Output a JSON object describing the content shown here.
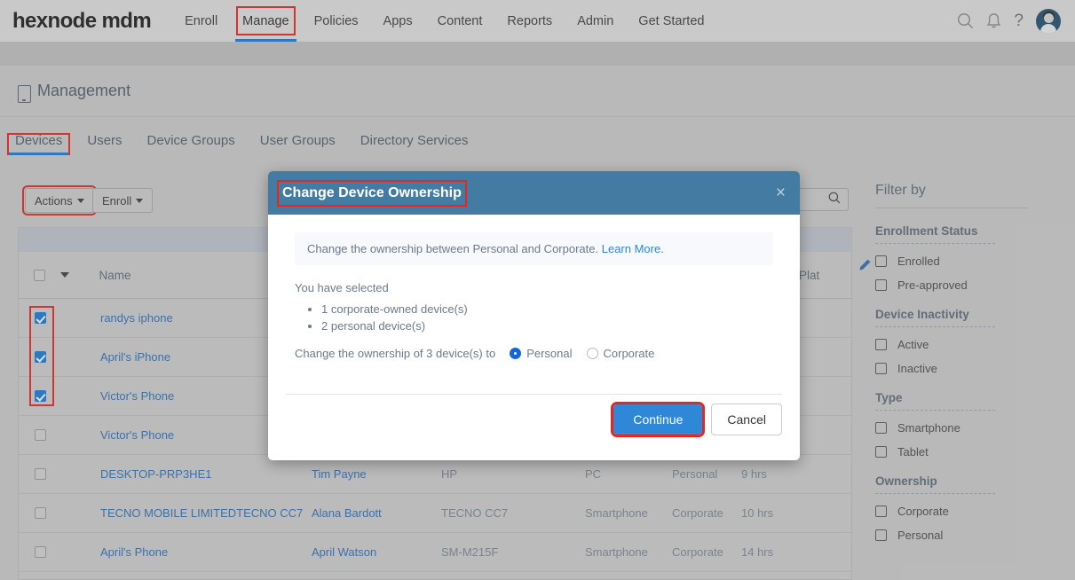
{
  "brand": {
    "logo": "hexnode mdm",
    "accent": "#1879d6",
    "modal_header": "#447ba3",
    "highlight": "#e8251f"
  },
  "topnav": {
    "items": [
      {
        "label": "Enroll",
        "active": false,
        "highlight": false
      },
      {
        "label": "Manage",
        "active": true,
        "highlight": true
      },
      {
        "label": "Policies",
        "active": false,
        "highlight": false
      },
      {
        "label": "Apps",
        "active": false,
        "highlight": false
      },
      {
        "label": "Content",
        "active": false,
        "highlight": false
      },
      {
        "label": "Reports",
        "active": false,
        "highlight": false
      },
      {
        "label": "Admin",
        "active": false,
        "highlight": false
      },
      {
        "label": "Get Started",
        "active": false,
        "highlight": false
      }
    ],
    "icons": [
      "search-icon",
      "notification-bell-icon",
      "help-icon",
      "user-avatar"
    ]
  },
  "page": {
    "title": "Management",
    "icon": "mobile-device-icon"
  },
  "tabs": [
    {
      "label": "Devices",
      "active": true,
      "highlight": true
    },
    {
      "label": "Users",
      "active": false,
      "highlight": false
    },
    {
      "label": "Device Groups",
      "active": false,
      "highlight": false
    },
    {
      "label": "User Groups",
      "active": false,
      "highlight": false
    },
    {
      "label": "Directory Services",
      "active": false,
      "highlight": false
    }
  ],
  "toolbar": {
    "actions_label": "Actions",
    "enroll_label": "Enroll",
    "search_placeholder": ""
  },
  "table": {
    "headers": {
      "name": "Name",
      "platform": "Plat"
    },
    "rows": [
      {
        "checked": true,
        "name": "randys iphone",
        "owner": "",
        "model": "",
        "type": "",
        "ownership": "",
        "last": ""
      },
      {
        "checked": true,
        "name": "April's iPhone",
        "owner": "",
        "model": "",
        "type": "",
        "ownership": "",
        "last": ""
      },
      {
        "checked": true,
        "name": "Victor's Phone",
        "owner": "",
        "model": "",
        "type": "",
        "ownership": "",
        "last": ""
      },
      {
        "checked": false,
        "name": "Victor's Phone",
        "owner": "",
        "model": "",
        "type": "",
        "ownership": "",
        "last": ""
      },
      {
        "checked": false,
        "name": "DESKTOP-PRP3HE1",
        "owner": "Tim Payne",
        "model": "HP",
        "type": "PC",
        "ownership": "Personal",
        "last": "9 hrs"
      },
      {
        "checked": false,
        "name": "TECNO MOBILE LIMITEDTECNO CC7",
        "owner": "Alana Bardott",
        "model": "TECNO CC7",
        "type": "Smartphone",
        "ownership": "Corporate",
        "last": "10 hrs"
      },
      {
        "checked": false,
        "name": "April's Phone",
        "owner": "April Watson",
        "model": "SM-M215F",
        "type": "Smartphone",
        "ownership": "Corporate",
        "last": "14 hrs"
      }
    ]
  },
  "filter": {
    "title": "Filter by",
    "sections": [
      {
        "title": "Enrollment Status",
        "options": [
          {
            "label": "Enrolled",
            "checked": false
          },
          {
            "label": "Pre-approved",
            "checked": false
          }
        ]
      },
      {
        "title": "Device Inactivity",
        "options": [
          {
            "label": "Active",
            "checked": false
          },
          {
            "label": "Inactive",
            "checked": false
          }
        ]
      },
      {
        "title": "Type",
        "options": [
          {
            "label": "Smartphone",
            "checked": false
          },
          {
            "label": "Tablet",
            "checked": false
          }
        ]
      },
      {
        "title": "Ownership",
        "options": [
          {
            "label": "Corporate",
            "checked": false
          },
          {
            "label": "Personal",
            "checked": false
          }
        ]
      }
    ]
  },
  "modal": {
    "title": "Change Device Ownership",
    "close_icon": "×",
    "info_text": "Change the ownership between Personal and Corporate.",
    "info_link": "Learn More.",
    "selected_label": "You have selected",
    "bullets": [
      "1 corporate-owned device(s)",
      "2 personal device(s)"
    ],
    "change_label": "Change the ownership of 3 device(s) to",
    "options": [
      {
        "label": "Personal",
        "selected": true
      },
      {
        "label": "Corporate",
        "selected": false
      }
    ],
    "continue_label": "Continue",
    "cancel_label": "Cancel"
  }
}
